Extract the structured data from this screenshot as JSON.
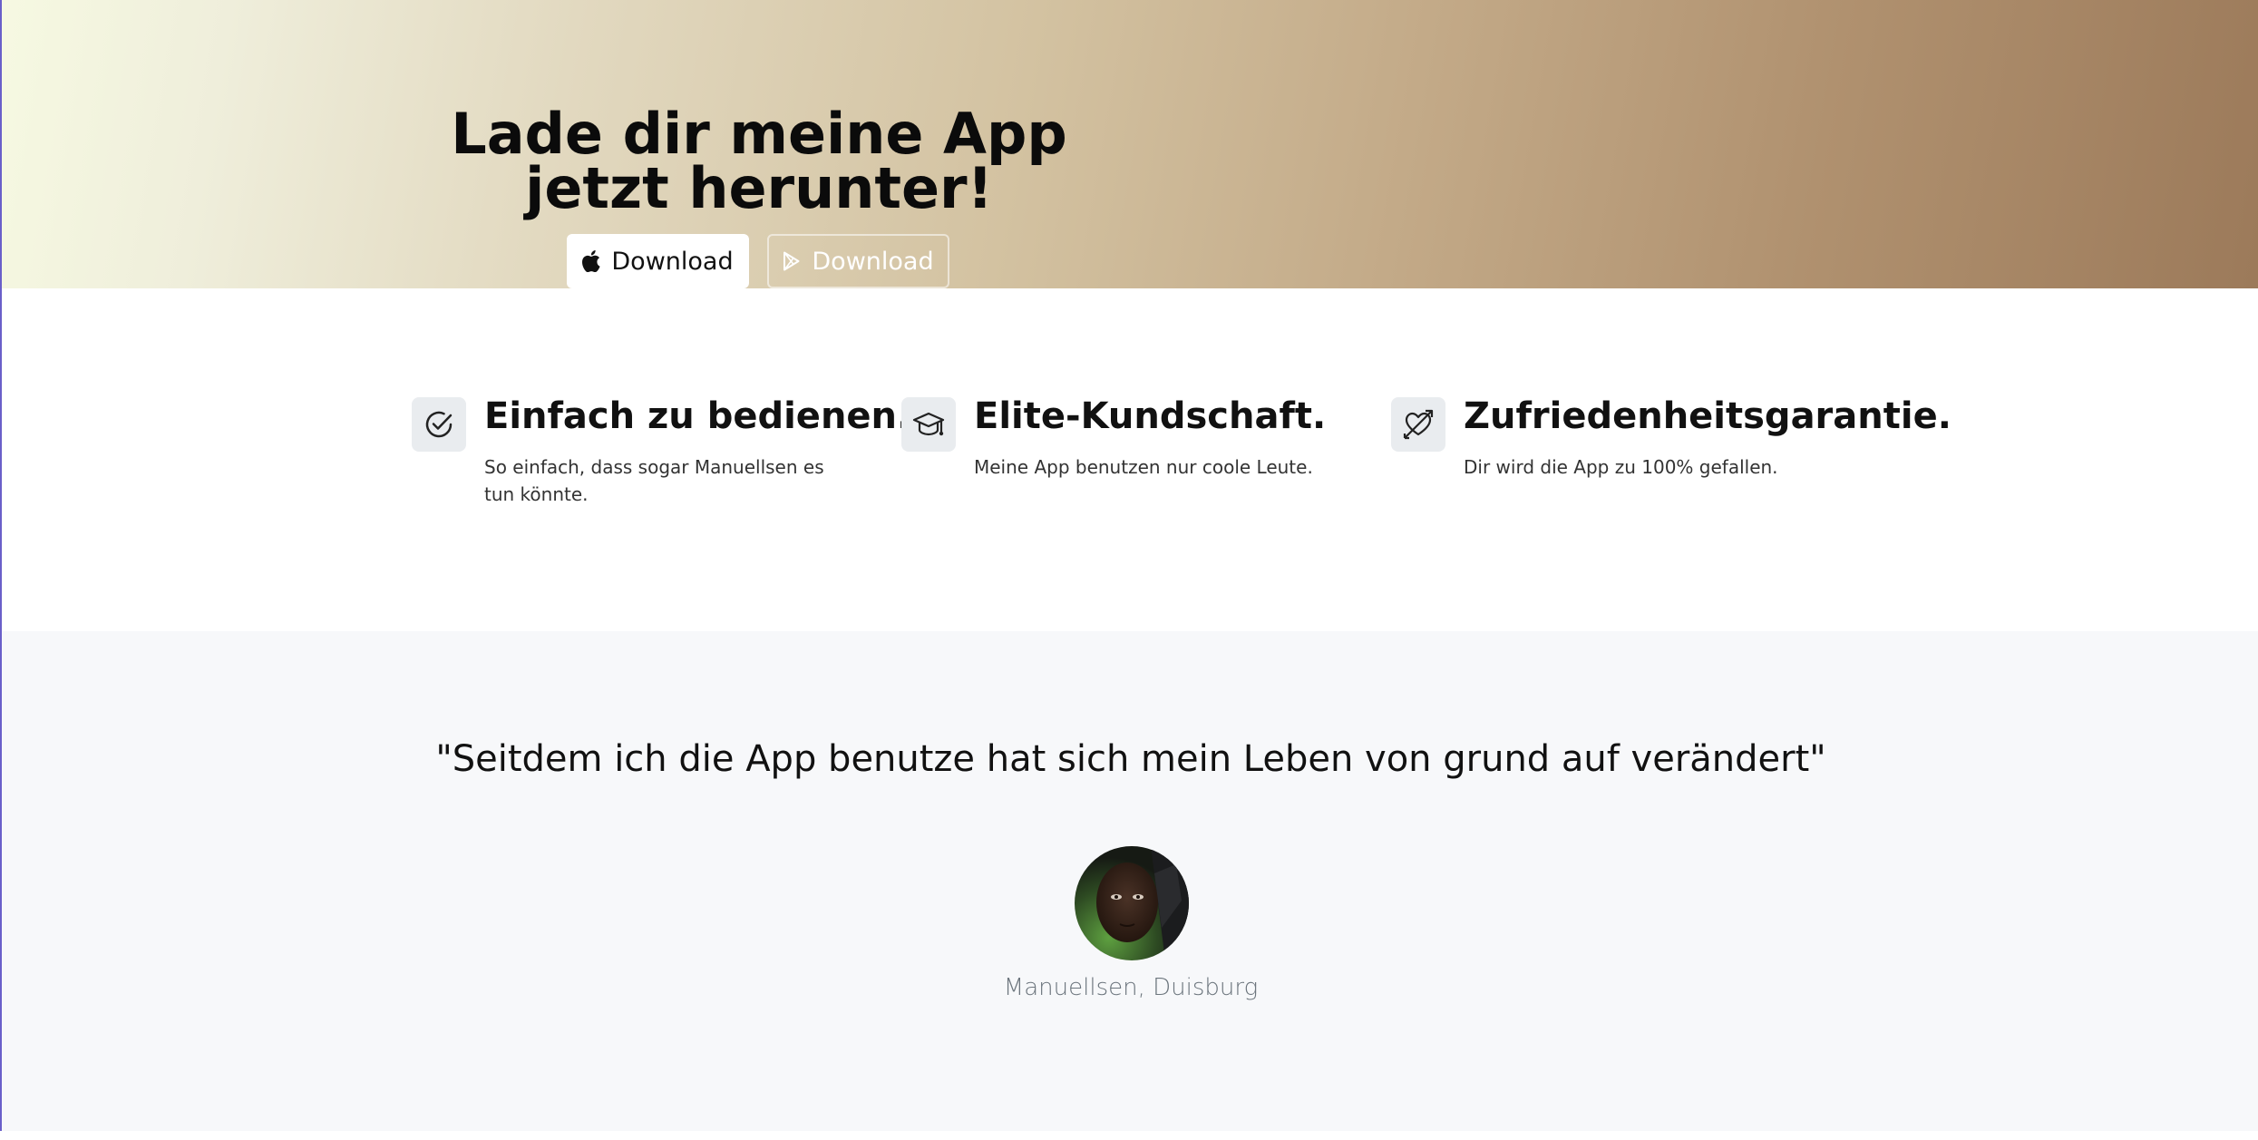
{
  "hero": {
    "title": "Lade dir meine App jetzt herunter!",
    "buttons": [
      {
        "label": "Download",
        "icon": "apple-icon"
      },
      {
        "label": "Download",
        "icon": "google-play-icon"
      }
    ]
  },
  "features": [
    {
      "icon": "check-circle-icon",
      "title": "Einfach zu bedienen.",
      "text": "So einfach, dass sogar Manuellsen es tun könnte."
    },
    {
      "icon": "graduation-cap-icon",
      "title": "Elite-Kundschaft.",
      "text": "Meine App benutzen nur coole Leute."
    },
    {
      "icon": "heart-arrow-icon",
      "title": "Zufriedenheitsgarantie.",
      "text": "Dir wird die App zu 100% gefallen."
    }
  ],
  "testimonial": {
    "quote": "\"Seitdem ich die App benutze hat sich mein Leben von grund auf verändert\"",
    "author": "Manuellsen, Duisburg"
  },
  "colors": {
    "hero_gradient_start": "#f6f9e2",
    "hero_gradient_end": "#9c7a5a",
    "testimonial_bg": "#f7f8fa",
    "icon_box_bg": "#e9ecef"
  }
}
